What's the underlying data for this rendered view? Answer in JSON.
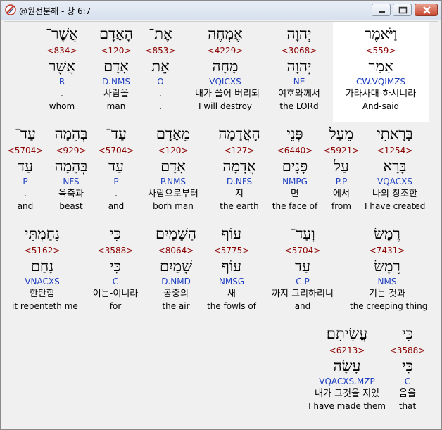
{
  "window": {
    "title": "@원전분해 - 창 6:7"
  },
  "rows": [
    [
      {
        "heb": "אֲשֶׁר־",
        "strong": "<834>",
        "lex": "אֲשֶׁר",
        "parse": "R",
        "kor": ".",
        "eng": "whom"
      },
      {
        "heb": "הָאָדָם",
        "strong": "<120>",
        "lex": "אָדָם",
        "parse": "D.NMS",
        "kor": "사람을",
        "eng": "man"
      },
      {
        "heb": "אֶת־",
        "strong": "<853>",
        "lex": "אֵת",
        "parse": "O",
        "kor": ".",
        "eng": "."
      },
      {
        "heb": "אֶמְחֶה",
        "strong": "<4229>",
        "lex": "מָחָה",
        "parse": "VQICXS",
        "kor": "내가 쓸어 버리되",
        "eng": "I will destroy"
      },
      {
        "heb": "יְהוָה",
        "strong": "<3068>",
        "lex": "יְהוָה",
        "parse": "NE",
        "kor": "여호와께서",
        "eng": "the LORd"
      },
      {
        "heb": "וַיֹּאמֶר",
        "strong": "<559>",
        "lex": "אָמַר",
        "parse": "CW.VQIMZS",
        "kor": "가라사대-하시니라",
        "eng": "And-said",
        "hl": true
      }
    ],
    [
      {
        "heb": "עַד־",
        "strong": "<5704>",
        "lex": "עַד",
        "parse": "P",
        "kor": ".",
        "eng": "and"
      },
      {
        "heb": "בְּהֵמָה",
        "strong": "<929>",
        "lex": "בְּהֵמָה",
        "parse": "NFS",
        "kor": "육축과",
        "eng": "beast"
      },
      {
        "heb": "עַד־",
        "strong": "<5704>",
        "lex": "עַד",
        "parse": "P",
        "kor": ".",
        "eng": "and"
      },
      {
        "heb": "מֵאָדָם",
        "strong": "<120>",
        "lex": "אָדָם",
        "parse": "P.NMS",
        "kor": "사람으로부터",
        "eng": "borh man"
      },
      {
        "heb": "הָאֲדָמָה",
        "strong": "<127>",
        "lex": "אֲדָמָה",
        "parse": "D.NFS",
        "kor": "지",
        "eng": "the earth"
      },
      {
        "heb": "פְּנֵי",
        "strong": "<6440>",
        "lex": "פָּנִים",
        "parse": "NMPG",
        "kor": "면",
        "eng": "the face of"
      },
      {
        "heb": "מֵעַל",
        "strong": "<5921>",
        "lex": "עַל",
        "parse": "P.P",
        "kor": "에서",
        "eng": "from"
      },
      {
        "heb": "בָּרָאתִי",
        "strong": "<1254>",
        "lex": "בָּרָא",
        "parse": "VQACXS",
        "kor": "나의 창조한",
        "eng": "I have created"
      }
    ],
    [
      {
        "heb": "נִחַמְתִּי",
        "strong": "<5162>",
        "lex": "נָחַם",
        "parse": "VNACXS",
        "kor": "한탄함",
        "eng": "it repenteth me"
      },
      {
        "heb": "כִּי",
        "strong": "<3588>",
        "lex": "כִּי",
        "parse": "C",
        "kor": "이는-이니라",
        "eng": "for"
      },
      {
        "heb": "הַשָּׁמַיִם",
        "strong": "<8064>",
        "lex": "שָׁמַיִם",
        "parse": "D.NMD",
        "kor": "공중의",
        "eng": "the air"
      },
      {
        "heb": "עוֹף",
        "strong": "<5775>",
        "lex": "עוֹף",
        "parse": "NMSG",
        "kor": "새",
        "eng": "the fowls of"
      },
      {
        "heb": "וְעַד־",
        "strong": "<5704>",
        "lex": "עַד",
        "parse": "C.P",
        "kor": "까지 그리하리니",
        "eng": "and"
      },
      {
        "heb": "רֶמֶשׂ",
        "strong": "<7431>",
        "lex": "רֶמֶשׂ",
        "parse": "NMS",
        "kor": "기는 것과",
        "eng": "the creeping thing"
      }
    ],
    [
      {
        "heb": "עֲשִׂיתִם׃",
        "strong": "<6213>",
        "lex": "עָשָׂה",
        "parse": "VQACXS.MZP",
        "kor": "내가 그것을 지었",
        "eng": "I have made them"
      },
      {
        "heb": "כִּי",
        "strong": "<3588>",
        "lex": "כִּי",
        "parse": "C",
        "kor": "음을",
        "eng": "that"
      }
    ]
  ]
}
